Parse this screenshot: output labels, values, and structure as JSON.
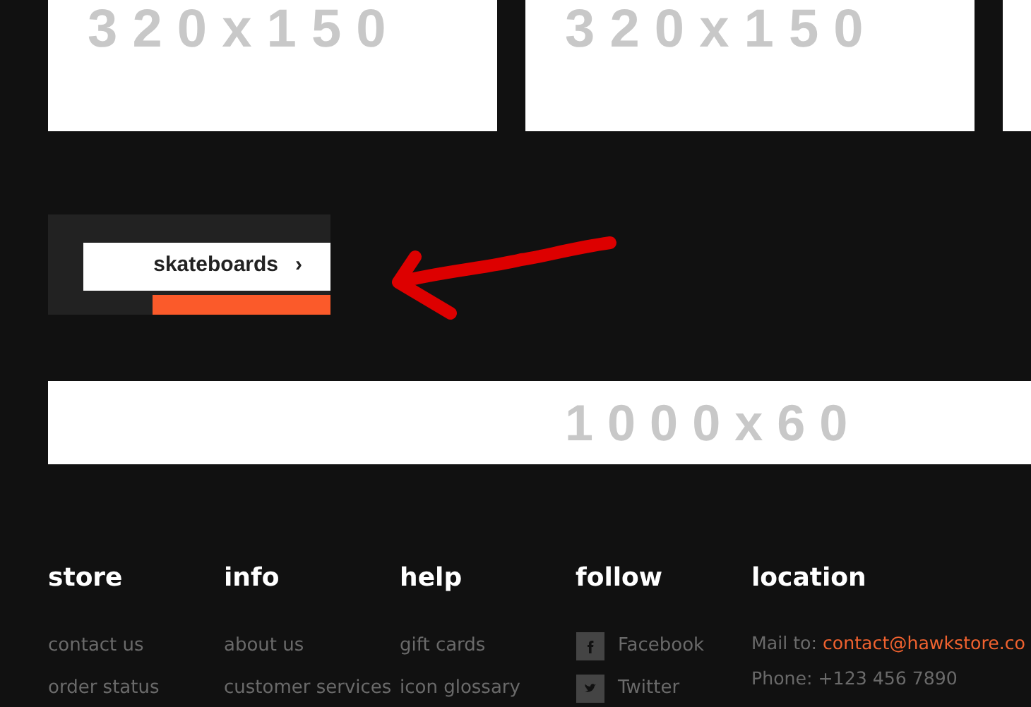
{
  "thumbnails": [
    {
      "kind": "placeholder",
      "label": "3 2 0 x 1 5 0"
    },
    {
      "kind": "placeholder",
      "label": "3 2 0 x 1 5 0"
    },
    {
      "kind": "placeholder"
    }
  ],
  "menu": {
    "items": [
      {
        "label": "skateboards",
        "arrow": "›",
        "kind": "link"
      },
      {
        "kind": "highlight"
      }
    ]
  },
  "banner": {
    "label": "1 0 0 0 x 6 0"
  },
  "footer": {
    "columns": [
      {
        "title": "store",
        "links": [
          "contact us",
          "order status"
        ]
      },
      {
        "title": "info",
        "links": [
          "about us",
          "customer services"
        ]
      },
      {
        "title": "help",
        "links": [
          "gift cards",
          "icon glossary"
        ]
      },
      {
        "title": "follow",
        "social": [
          {
            "label": "Facebook"
          },
          {
            "label": "Twitter"
          }
        ]
      },
      {
        "title": "location",
        "contact": [
          {
            "label": "Mail to:",
            "link": "contact@hawkstore.co"
          },
          {
            "label": "Phone: +123 456 7890"
          }
        ]
      }
    ]
  }
}
